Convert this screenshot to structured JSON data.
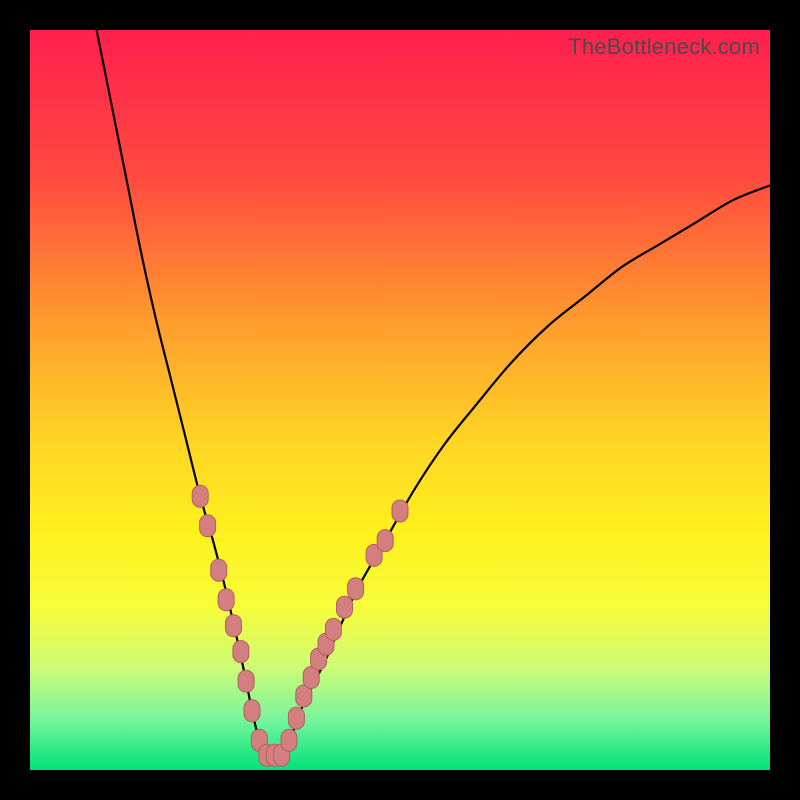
{
  "watermark": "TheBottleneck.com",
  "colors": {
    "frame": "#000000",
    "curve": "#000000",
    "marker_fill": "#d47f7f",
    "marker_stroke": "#b25f5f",
    "gradient_stops": [
      {
        "offset": 0.0,
        "color": "#ff1f4e"
      },
      {
        "offset": 0.2,
        "color": "#ff4a3f"
      },
      {
        "offset": 0.4,
        "color": "#ff9e2d"
      },
      {
        "offset": 0.55,
        "color": "#ffd324"
      },
      {
        "offset": 0.68,
        "color": "#fef11e"
      },
      {
        "offset": 0.78,
        "color": "#f6fd3a"
      },
      {
        "offset": 0.86,
        "color": "#cffb75"
      },
      {
        "offset": 0.93,
        "color": "#7af59c"
      },
      {
        "offset": 1.0,
        "color": "#00e27a"
      }
    ]
  },
  "chart_data": {
    "type": "line",
    "title": "",
    "xlabel": "",
    "ylabel": "",
    "xlim": [
      0,
      100
    ],
    "ylim": [
      0,
      100
    ],
    "grid": false,
    "series": [
      {
        "name": "bottleneck-curve",
        "x": [
          9,
          11,
          13,
          15,
          17,
          19,
          21,
          23,
          25,
          27,
          29,
          30,
          31,
          32,
          33,
          35,
          37,
          40,
          44,
          48,
          52,
          56,
          60,
          65,
          70,
          75,
          80,
          85,
          90,
          95,
          100
        ],
        "values": [
          100,
          90,
          80,
          70,
          61,
          53,
          45,
          37,
          30,
          22,
          13,
          8,
          4,
          2,
          2,
          4,
          9,
          15,
          24,
          31,
          38,
          44,
          49,
          55,
          60,
          64,
          68,
          71,
          74,
          77,
          79
        ]
      }
    ],
    "markers": {
      "name": "highlighted-points",
      "style": "pill",
      "points": [
        {
          "x": 23.0,
          "y": 37.0
        },
        {
          "x": 24.0,
          "y": 33.0
        },
        {
          "x": 25.5,
          "y": 27.0
        },
        {
          "x": 26.5,
          "y": 23.0
        },
        {
          "x": 27.5,
          "y": 19.5
        },
        {
          "x": 28.5,
          "y": 16.0
        },
        {
          "x": 29.2,
          "y": 12.0
        },
        {
          "x": 30.0,
          "y": 8.0
        },
        {
          "x": 31.0,
          "y": 4.0
        },
        {
          "x": 32.0,
          "y": 2.0
        },
        {
          "x": 33.0,
          "y": 2.0
        },
        {
          "x": 34.0,
          "y": 2.0
        },
        {
          "x": 35.0,
          "y": 4.0
        },
        {
          "x": 36.0,
          "y": 7.0
        },
        {
          "x": 37.0,
          "y": 10.0
        },
        {
          "x": 38.0,
          "y": 12.5
        },
        {
          "x": 39.0,
          "y": 15.0
        },
        {
          "x": 40.0,
          "y": 17.0
        },
        {
          "x": 41.0,
          "y": 19.0
        },
        {
          "x": 42.5,
          "y": 22.0
        },
        {
          "x": 44.0,
          "y": 24.5
        },
        {
          "x": 46.5,
          "y": 29.0
        },
        {
          "x": 48.0,
          "y": 31.0
        },
        {
          "x": 50.0,
          "y": 35.0
        }
      ]
    }
  }
}
